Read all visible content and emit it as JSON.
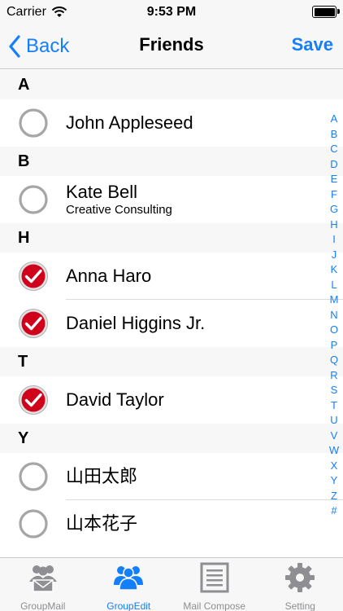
{
  "status_bar": {
    "carrier": "Carrier",
    "time": "9:53 PM"
  },
  "nav": {
    "back_label": "Back",
    "title": "Friends",
    "save_label": "Save"
  },
  "sections": [
    {
      "letter": "A",
      "rows": [
        {
          "name": "John Appleseed",
          "subtitle": "",
          "checked": false
        }
      ]
    },
    {
      "letter": "B",
      "rows": [
        {
          "name": "Kate Bell",
          "subtitle": "Creative Consulting",
          "checked": false
        }
      ]
    },
    {
      "letter": "H",
      "rows": [
        {
          "name": "Anna Haro",
          "subtitle": "",
          "checked": true
        },
        {
          "name": "Daniel Higgins Jr.",
          "subtitle": "",
          "checked": true
        }
      ]
    },
    {
      "letter": "T",
      "rows": [
        {
          "name": "David Taylor",
          "subtitle": "",
          "checked": true
        }
      ]
    },
    {
      "letter": "Y",
      "rows": [
        {
          "name": "山田太郎",
          "subtitle": "",
          "checked": false
        },
        {
          "name": "山本花子",
          "subtitle": "",
          "checked": false
        }
      ]
    }
  ],
  "index_letters": [
    "A",
    "B",
    "C",
    "D",
    "E",
    "F",
    "G",
    "H",
    "I",
    "J",
    "K",
    "L",
    "M",
    "N",
    "O",
    "P",
    "Q",
    "R",
    "S",
    "T",
    "U",
    "V",
    "W",
    "X",
    "Y",
    "Z",
    "#"
  ],
  "tabs": [
    {
      "label": "GroupMail",
      "icon": "group-mail-icon",
      "active": false
    },
    {
      "label": "GroupEdit",
      "icon": "group-edit-icon",
      "active": true
    },
    {
      "label": "Mail Compose",
      "icon": "compose-icon",
      "active": false
    },
    {
      "label": "Setting",
      "icon": "gear-icon",
      "active": false
    }
  ],
  "colors": {
    "accent": "#157efb",
    "check_red": "#d0021b",
    "bar_bg": "#f7f7f7",
    "tab_inactive": "#8e8e93"
  }
}
